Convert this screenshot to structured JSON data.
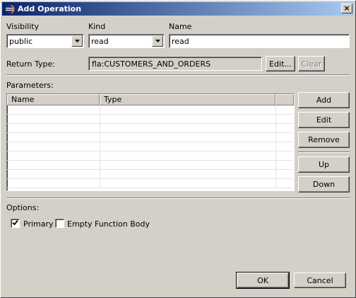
{
  "window": {
    "title": "Add Operation",
    "close_glyph": "×"
  },
  "visibility": {
    "label": "Visibility",
    "value": "public"
  },
  "kind": {
    "label": "Kind",
    "value": "read"
  },
  "name": {
    "label": "Name",
    "value": "read"
  },
  "return_type": {
    "label": "Return Type:",
    "value": "fla:CUSTOMERS_AND_ORDERS",
    "edit_label": "Edit...",
    "clear_label": "Clear"
  },
  "parameters": {
    "label": "Parameters:",
    "columns": [
      "Name",
      "Type"
    ],
    "rows": [],
    "buttons": {
      "add": "Add",
      "edit": "Edit",
      "remove": "Remove",
      "up": "Up",
      "down": "Down"
    }
  },
  "options": {
    "label": "Options:",
    "primary": {
      "label": "Primary",
      "checked": true
    },
    "empty_body": {
      "label": "Empty Function Body",
      "checked": false
    }
  },
  "footer": {
    "ok_label": "OK",
    "cancel_label": "Cancel"
  },
  "colors": {
    "titlebar_start": "#0a246a",
    "titlebar_end": "#a6caf0",
    "dialog_bg": "#d4d0c8"
  },
  "icons": {
    "app": "eclipse-icon",
    "dropdown": "chevron-down-icon",
    "check": "checkmark-icon"
  }
}
